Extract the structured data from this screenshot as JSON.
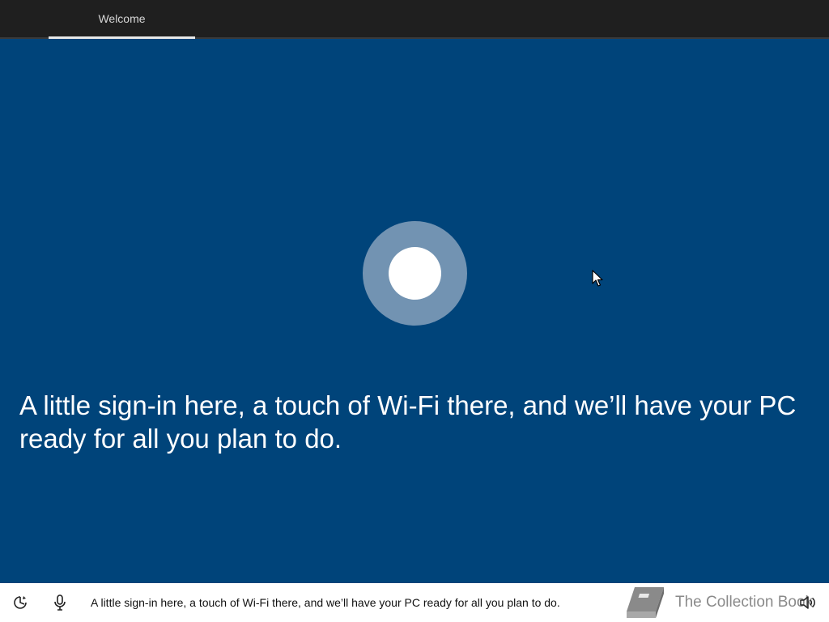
{
  "header": {
    "tab_label": "Welcome"
  },
  "main": {
    "headline": "A little sign-in here, a touch of Wi-Fi there, and we’ll have your PC ready for all you plan to do."
  },
  "footer": {
    "caption": "A little sign-in here, a touch of Wi-Fi there, and we’ll have your PC ready for all you plan to do.",
    "watermark_text": "The Collection Book",
    "icons": [
      "ease-of-access-icon",
      "microphone-icon",
      "volume-icon"
    ]
  },
  "colors": {
    "background": "#00447a",
    "topbar": "#1f1f1f",
    "cortana_ring": "#7293b2",
    "bottombar": "#ffffff"
  }
}
